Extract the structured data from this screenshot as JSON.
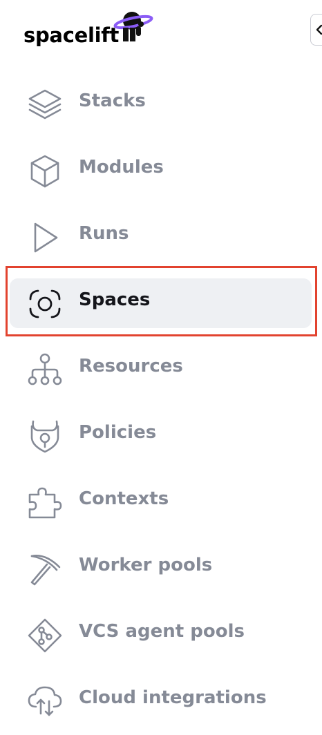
{
  "brand": {
    "name": "spacelift",
    "accent": "#8b5cf6"
  },
  "collapse": {
    "icon": "chevron-left-icon"
  },
  "nav": {
    "items": [
      {
        "label": "Stacks",
        "icon": "stack-layers-icon",
        "active": false
      },
      {
        "label": "Modules",
        "icon": "cube-icon",
        "active": false
      },
      {
        "label": "Runs",
        "icon": "play-icon",
        "active": false
      },
      {
        "label": "Spaces",
        "icon": "focus-circle-icon",
        "active": true
      },
      {
        "label": "Resources",
        "icon": "resource-tree-icon",
        "active": false
      },
      {
        "label": "Policies",
        "icon": "shield-horns-icon",
        "active": false
      },
      {
        "label": "Contexts",
        "icon": "puzzle-icon",
        "active": false
      },
      {
        "label": "Worker pools",
        "icon": "pickaxe-icon",
        "active": false
      },
      {
        "label": "VCS agent pools",
        "icon": "git-diamond-icon",
        "active": false
      },
      {
        "label": "Cloud integrations",
        "icon": "cloud-transfer-icon",
        "active": false
      }
    ]
  },
  "colors": {
    "inactive_text": "#858a96",
    "active_text": "#14151a",
    "active_bg": "#eef0f3",
    "highlight_border": "#e2432f"
  }
}
